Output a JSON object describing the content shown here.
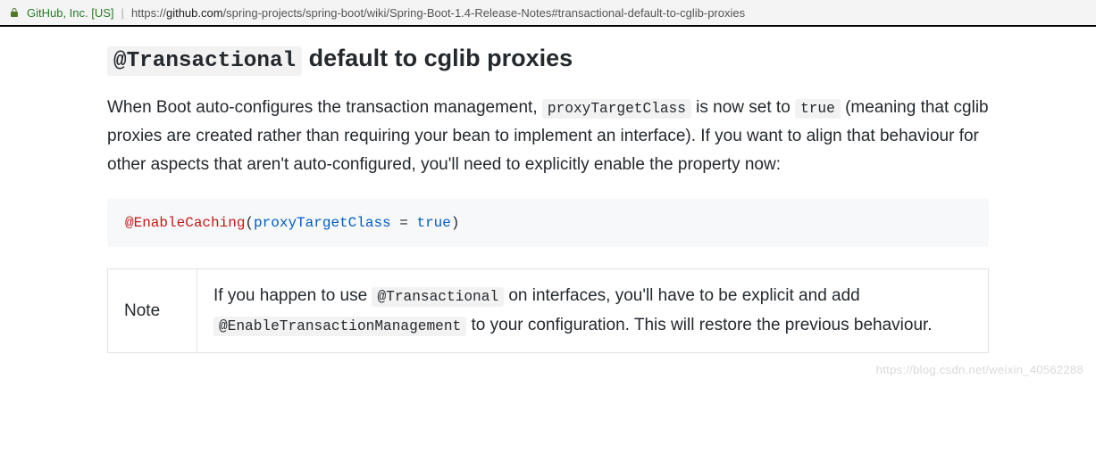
{
  "addressbar": {
    "identity": "GitHub, Inc. [US]",
    "separator": "|",
    "url_prefix": "https://",
    "url_host": "github.com",
    "url_path": "/spring-projects/spring-boot/wiki/Spring-Boot-1.4-Release-Notes#transactional-default-to-cglib-proxies"
  },
  "heading": {
    "code": "@Transactional",
    "rest": " default to cglib proxies"
  },
  "paragraph": {
    "t1": "When Boot auto-configures the transaction management, ",
    "c1": "proxyTargetClass",
    "t2": " is now set to ",
    "c2": "true",
    "t3": " (meaning that cglib proxies are created rather than requiring your bean to implement an interface). If you want to align that behaviour for other aspects that aren't auto-configured, you'll need to explicitly enable the property now:"
  },
  "codeblock": {
    "anno": "@EnableCaching",
    "open": "(",
    "param": "proxyTargetClass",
    "eq": " = ",
    "val": "true",
    "close": ")"
  },
  "note": {
    "label": "Note",
    "t1": "If you happen to use ",
    "c1": "@Transactional",
    "t2": " on interfaces, you'll have to be explicit and add ",
    "c2": "@EnableTransactionManagement",
    "t3": " to your configuration. This will restore the previous behaviour."
  },
  "watermark": "https://blog.csdn.net/weixin_40562288"
}
